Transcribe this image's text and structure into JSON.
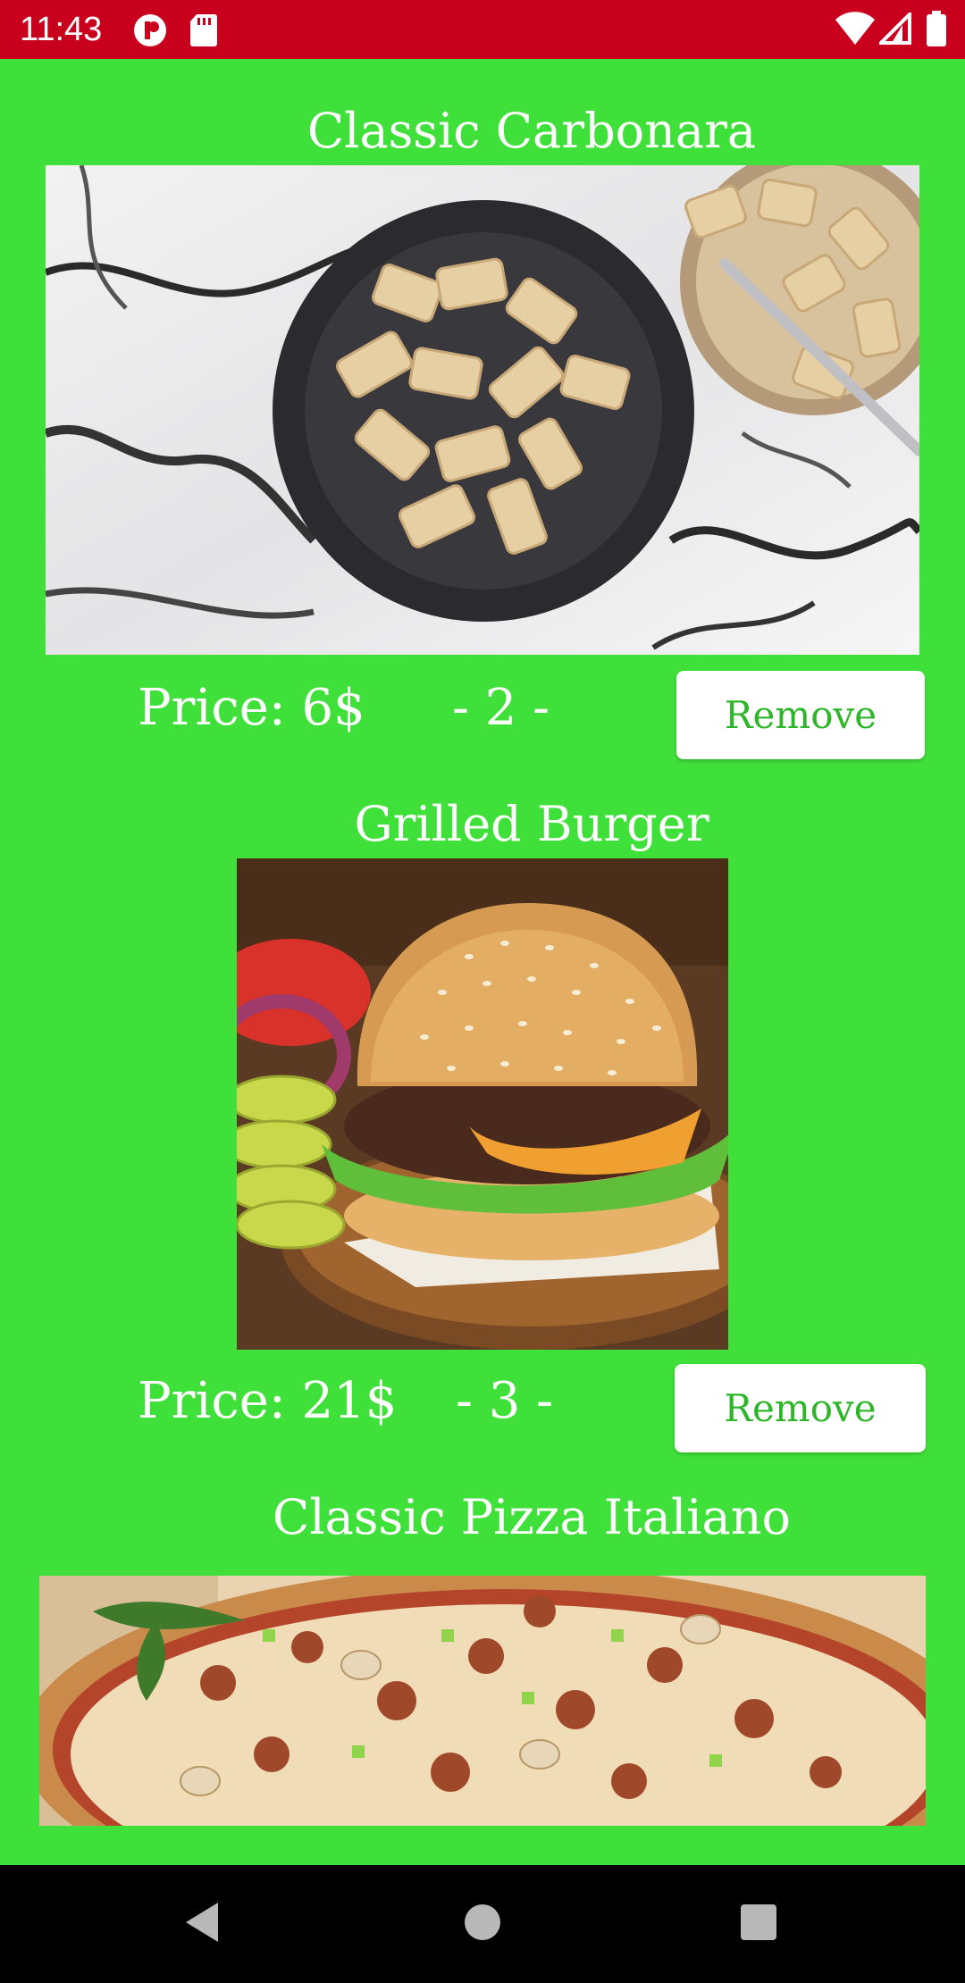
{
  "status_bar": {
    "time": "11:43",
    "icons": [
      "notification-app-icon",
      "sd-card-icon",
      "wifi-icon",
      "signal-icon",
      "battery-icon"
    ],
    "color": "#c8001e"
  },
  "background_color": "#40e03a",
  "cart": {
    "items": [
      {
        "title": "Classic Carbonara",
        "image": "carbonara-pasta-photo",
        "price": "Price: 6$",
        "quantity": "- 2 -",
        "remove_label": "Remove"
      },
      {
        "title": "Grilled Burger",
        "image": "grilled-burger-photo",
        "price": "Price: 21$",
        "quantity": "- 3 -",
        "remove_label": "Remove"
      },
      {
        "title": "Classic Pizza Italiano",
        "image": "pizza-photo"
      }
    ]
  },
  "nav_bar": {
    "icons": [
      "back-icon",
      "home-icon",
      "recents-icon"
    ]
  }
}
